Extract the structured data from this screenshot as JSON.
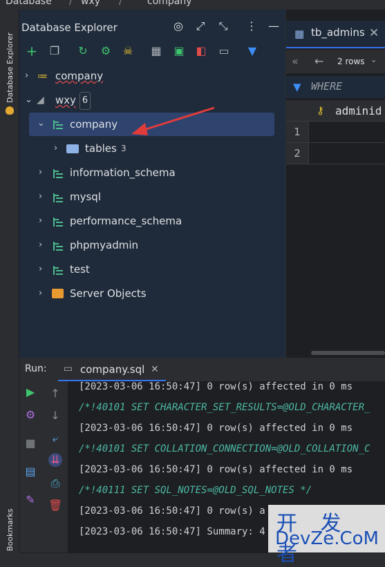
{
  "breadcrumb": {
    "item1": "Database",
    "item2": "wxy",
    "item3": "company"
  },
  "left_strip": {
    "db_explorer_label": "Database Explorer",
    "bookmarks_label": "Bookmarks"
  },
  "explorer": {
    "title": "Database Explorer",
    "tree": {
      "company_top": "company",
      "wxy": "wxy",
      "wxy_count": "6",
      "company_schema": "company",
      "tables": "tables",
      "tables_count": "3",
      "information_schema": "information_schema",
      "mysql": "mysql",
      "performance_schema": "performance_schema",
      "phpmyadmin": "phpmyadmin",
      "test": "test",
      "server_objects": "Server Objects"
    }
  },
  "data_panel": {
    "tab_title": "tb_admins",
    "rows_select": "2 rows",
    "where_label": "WHERE",
    "column_header": "adminid",
    "row_numbers": [
      "1",
      "2"
    ]
  },
  "run": {
    "label": "Run:",
    "tab_title": "company.sql",
    "log": [
      {
        "text": "[2023-03-06 16:50:47] 0 row(s) affected in 0 ms",
        "kind": "plain"
      },
      {
        "text": "/*!40101 SET CHARACTER_SET_RESULTS=@OLD_CHARACTER_",
        "kind": "comment"
      },
      {
        "text": "[2023-03-06 16:50:47] 0 row(s) affected in 0 ms",
        "kind": "plain"
      },
      {
        "text": "/*!40101 SET COLLATION_CONNECTION=@OLD_COLLATION_C",
        "kind": "comment"
      },
      {
        "text": "[2023-03-06 16:50:47] 0 row(s) affected in 0 ms",
        "kind": "plain"
      },
      {
        "text": "/*!40111 SET SQL_NOTES=@OLD_SQL_NOTES */",
        "kind": "comment"
      },
      {
        "text": "[2023-03-06 16:50:47] 0 row(s) a",
        "kind": "plain"
      },
      {
        "text": "[2023-03-06 16:50:47] Summary: 4",
        "kind": "plain"
      }
    ]
  },
  "watermark": {
    "line1": "开 发 者",
    "line2": "DevZe.CoM"
  },
  "colors": {
    "accent": "#3574f0",
    "schema_icon": "#4dbb8f",
    "comment": "#4cb9a4",
    "annotation_arrow": "#e03c3c"
  }
}
